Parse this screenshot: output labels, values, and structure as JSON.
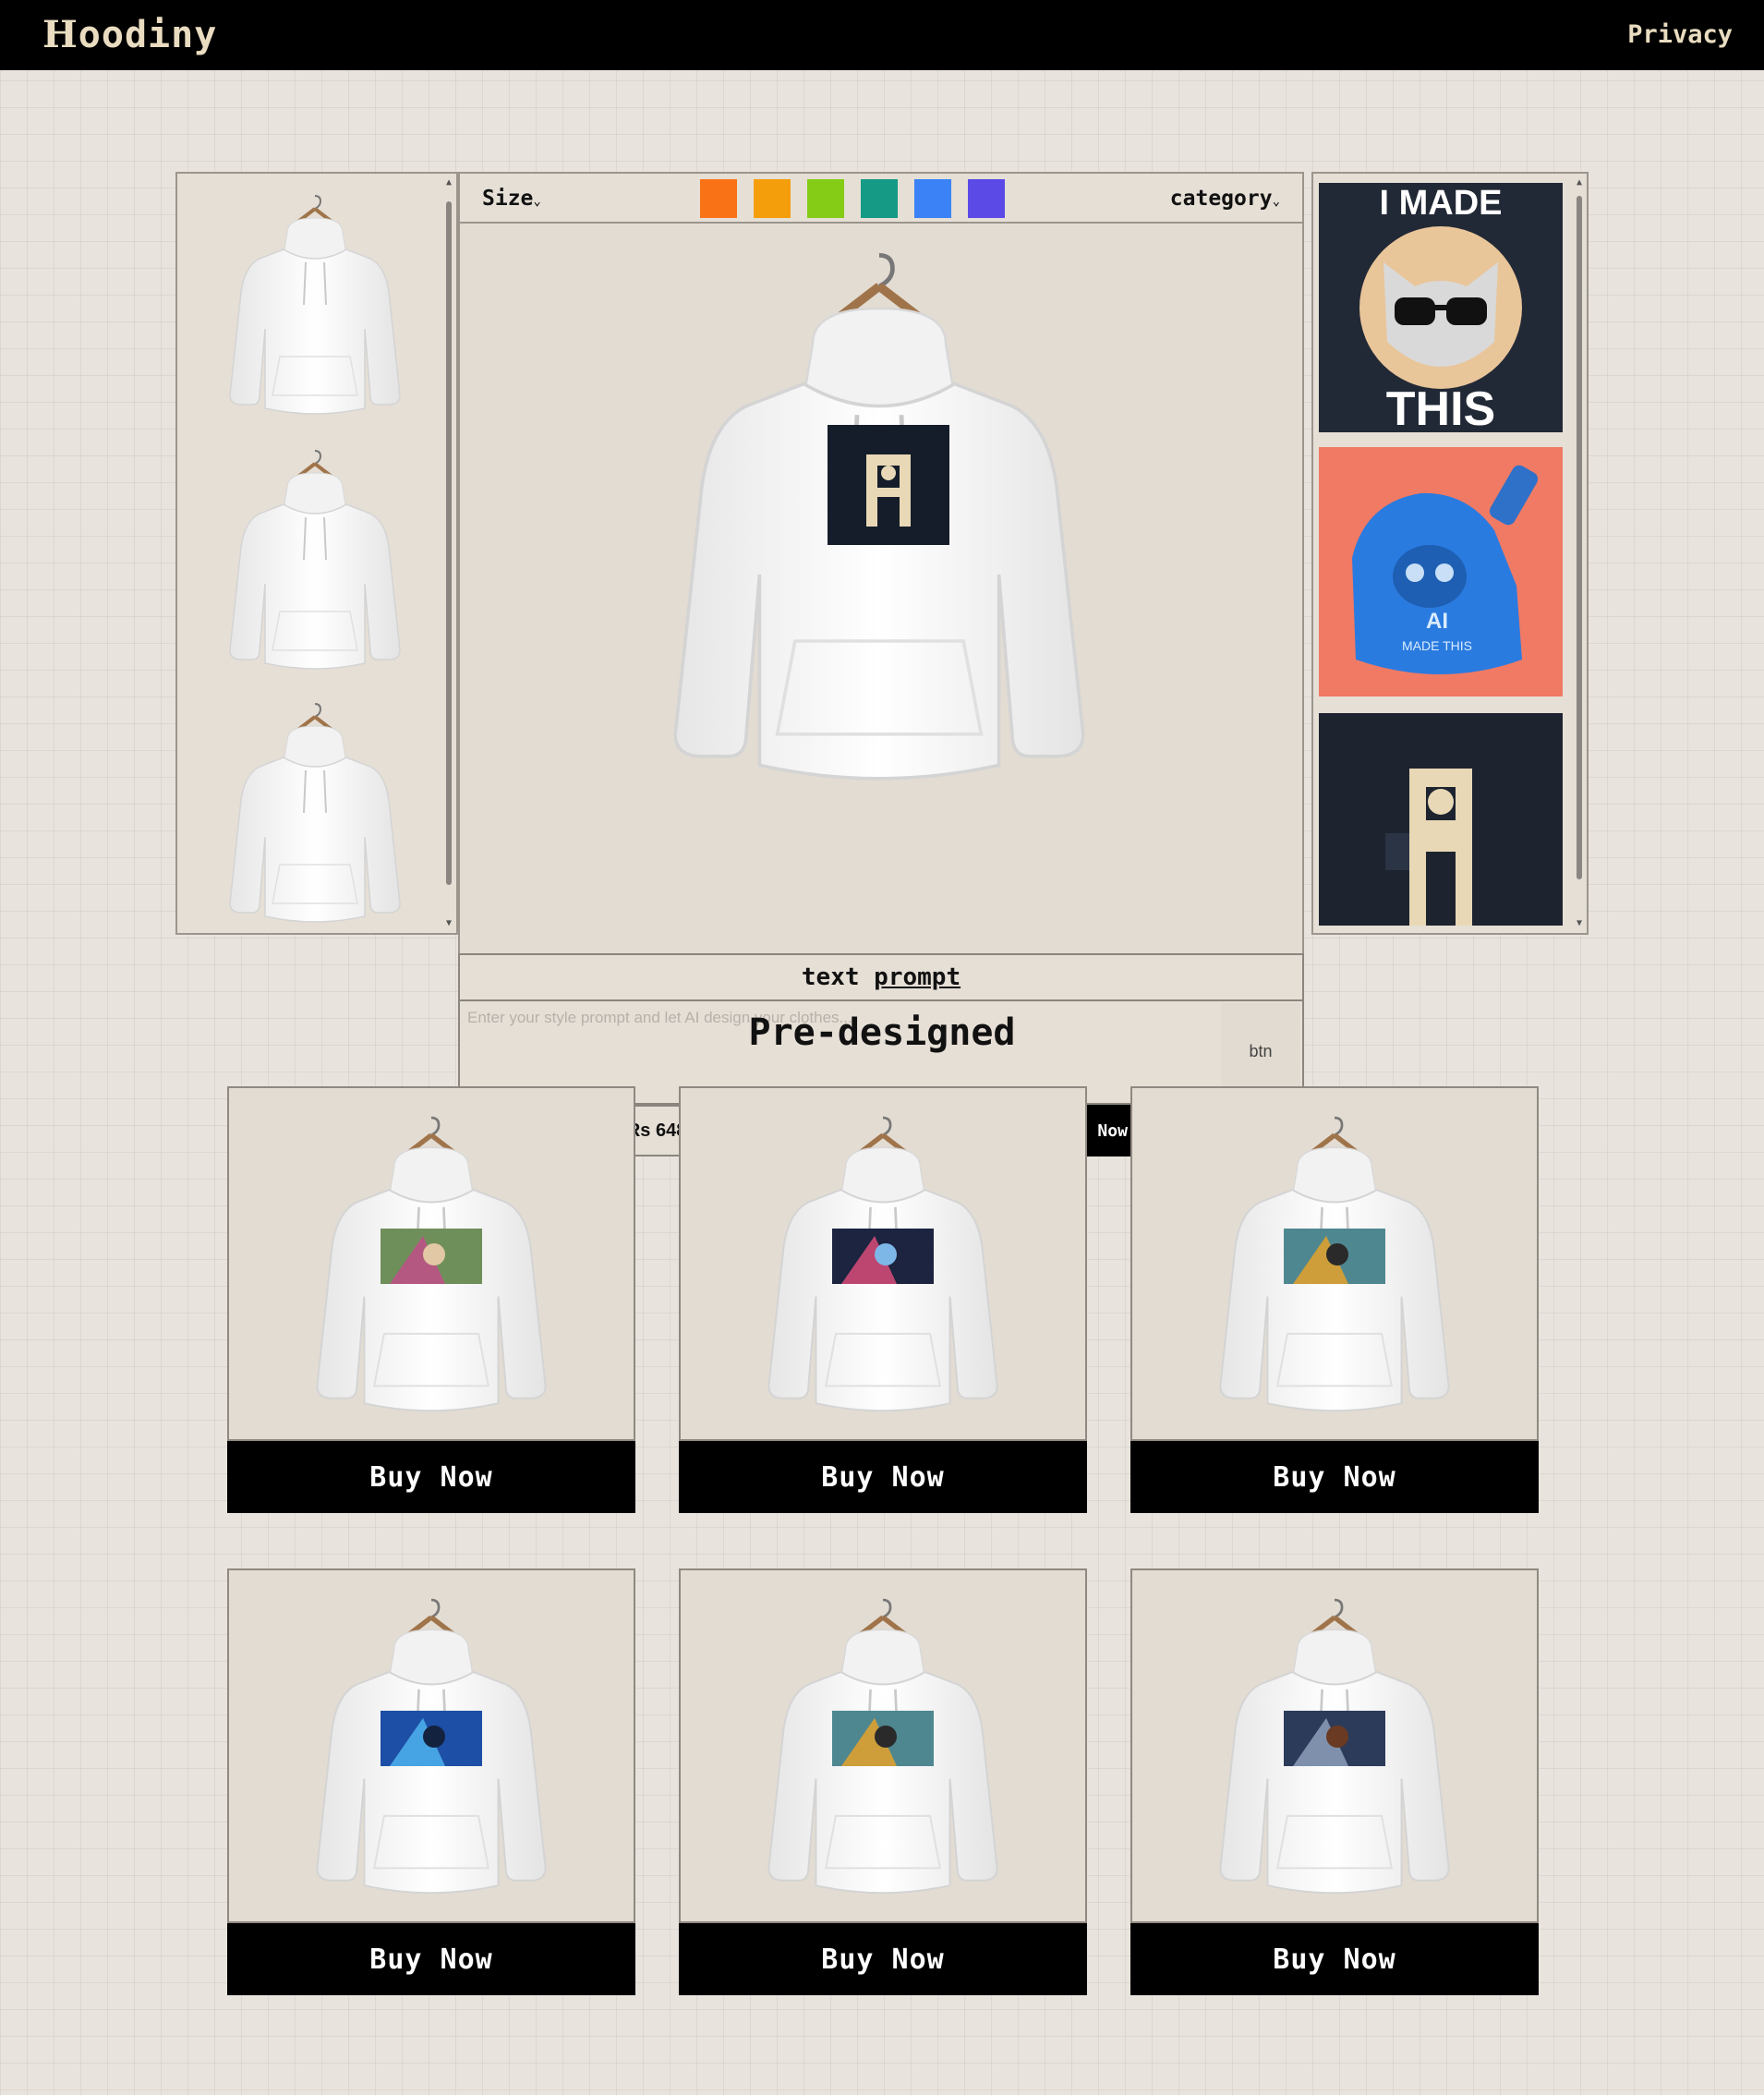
{
  "header": {
    "brand_first": "H",
    "brand_rest": "oodiny",
    "privacy": "Privacy"
  },
  "toolbar": {
    "size_label": "Size",
    "category_label": "category",
    "colors": [
      "#f97316",
      "#f59e0b",
      "#84cc16",
      "#159a86",
      "#3b82f6",
      "#5b4ae6"
    ]
  },
  "left_panel": {
    "thumbnails": [
      "white-hoodie",
      "white-hoodie",
      "white-hoodie"
    ]
  },
  "right_panel": {
    "artworks": [
      {
        "top_text": "I MADE",
        "bottom_text": "THIS"
      },
      {
        "text_line1": "AI",
        "text_line2": "MADE THIS"
      },
      {
        "name": "letter-h-character-art"
      }
    ]
  },
  "prompt": {
    "title_plain": "text ",
    "title_underlined": "prompt",
    "placeholder": "Enter your style prompt and let AI design your clothes...",
    "button_label": "btn"
  },
  "order": {
    "price": "Rs 648.00",
    "buy_label": "Buy Now"
  },
  "predesigned": {
    "title": "Pre-designed",
    "products": [
      {
        "buy_label": "Buy Now",
        "print_colors": [
          "#6f8f5a",
          "#c14f8a",
          "#e2c8a4"
        ]
      },
      {
        "buy_label": "Buy Now",
        "print_colors": [
          "#1c2440",
          "#d94c7a",
          "#7db7e8"
        ]
      },
      {
        "buy_label": "Buy Now",
        "print_colors": [
          "#4f8790",
          "#e3a22b",
          "#2a2a2a"
        ]
      },
      {
        "buy_label": "Buy Now",
        "print_colors": [
          "#1e4fa6",
          "#4fb3ef",
          "#13223f"
        ]
      },
      {
        "buy_label": "Buy Now",
        "print_colors": [
          "#4f8790",
          "#e3a22b",
          "#2a2a2a"
        ]
      },
      {
        "buy_label": "Buy Now",
        "print_colors": [
          "#2d3b5a",
          "#8da0bb",
          "#6a3a22"
        ]
      }
    ]
  }
}
